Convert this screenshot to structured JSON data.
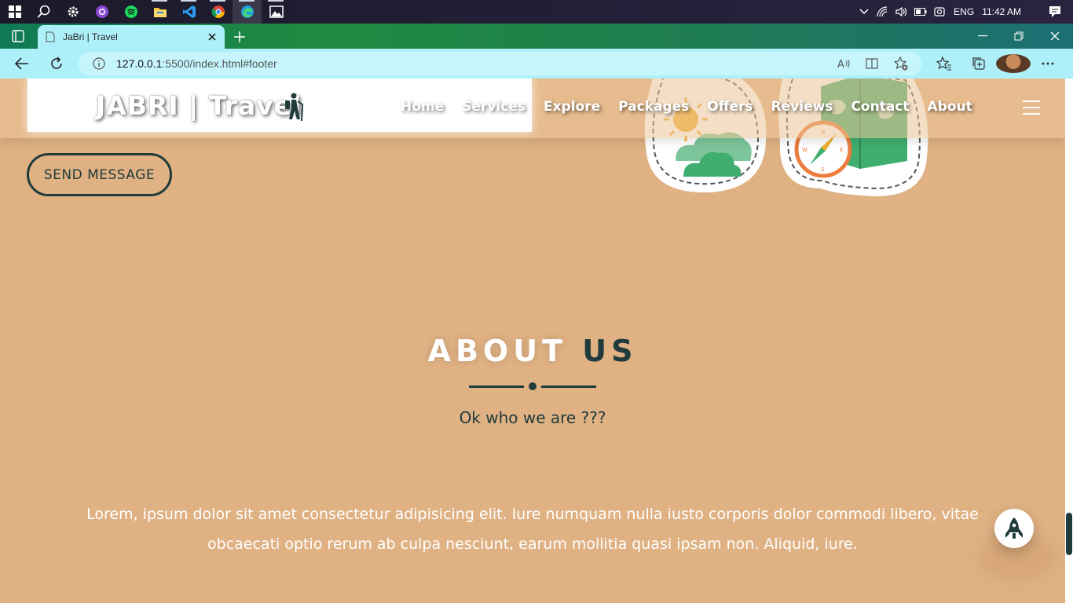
{
  "taskbar": {
    "apps": [
      {
        "name": "windows-start-icon"
      },
      {
        "name": "search-icon"
      },
      {
        "name": "settings-icon"
      },
      {
        "name": "github-desktop-icon"
      },
      {
        "name": "spotify-icon"
      },
      {
        "name": "file-explorer-icon"
      },
      {
        "name": "vscode-icon"
      },
      {
        "name": "chrome-icon"
      },
      {
        "name": "edge-icon"
      },
      {
        "name": "photos-icon"
      }
    ],
    "tray": {
      "language": "ENG",
      "time": "11:42 AM"
    }
  },
  "browser": {
    "tab_title": "JaBri | Travel",
    "url_host": "127.0.0.1",
    "url_path": ":5500/index.html#footer"
  },
  "site": {
    "brand": "JABRI | Travel",
    "nav": [
      "Home",
      "Services",
      "Explore",
      "Packages",
      "Offers",
      "Reviews",
      "Contact",
      "About"
    ],
    "send_button": "SEND MESSAGE",
    "about_title_part1": "ABOUT",
    "about_title_part2": "US",
    "about_title_o": "O",
    "about_subtitle": "Ok who we are ???",
    "about_text": "Lorem, ipsum dolor sit amet consectetur adipisicing elit. Iure numquam nulla iusto corporis dolor commodi libero, vitae obcaecati optio rerum ab culpa nesciunt, earum mollitia quasi ipsam non. Aliquid, iure."
  },
  "colors": {
    "page_bg": "#dfb183",
    "accent_dark": "#1f3b3c",
    "browser_toolbar": "#aef0f9"
  }
}
